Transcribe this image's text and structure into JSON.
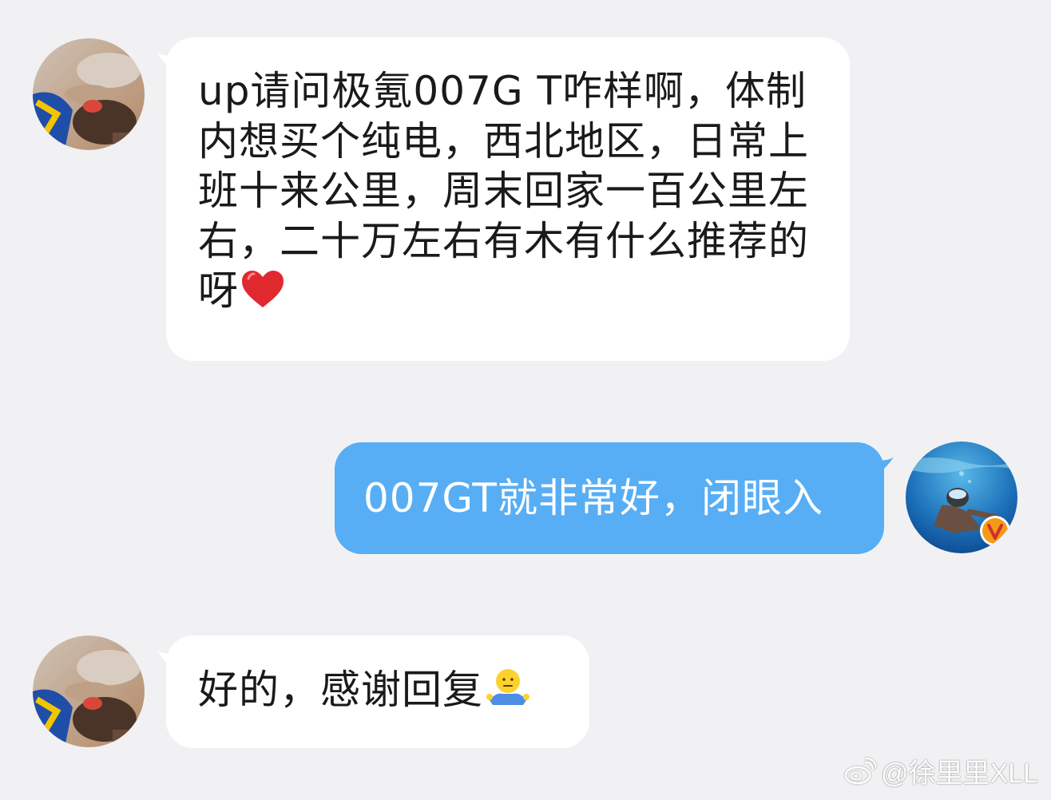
{
  "chat": {
    "messages": [
      {
        "side": "incoming",
        "text": "up请问极氪007G T咋样啊，体制内想买个纯电，西北地区，日常上班十来公里，周末回家一百公里左右，二十万左右有木有什么推荐的呀",
        "emoji": "heart-emoji"
      },
      {
        "side": "outgoing",
        "text": "007GT就非常好，闭眼入"
      },
      {
        "side": "incoming",
        "text": "好的，感谢回复",
        "emoji": "shrug-emoji"
      }
    ]
  },
  "watermark": {
    "text": "@徐里里XLL",
    "icon": "weibo-logo"
  },
  "colors": {
    "background": "#f1f1f3",
    "incoming_bubble": "#ffffff",
    "outgoing_bubble": "#57aef5",
    "verified_badge": "#f29b17"
  }
}
